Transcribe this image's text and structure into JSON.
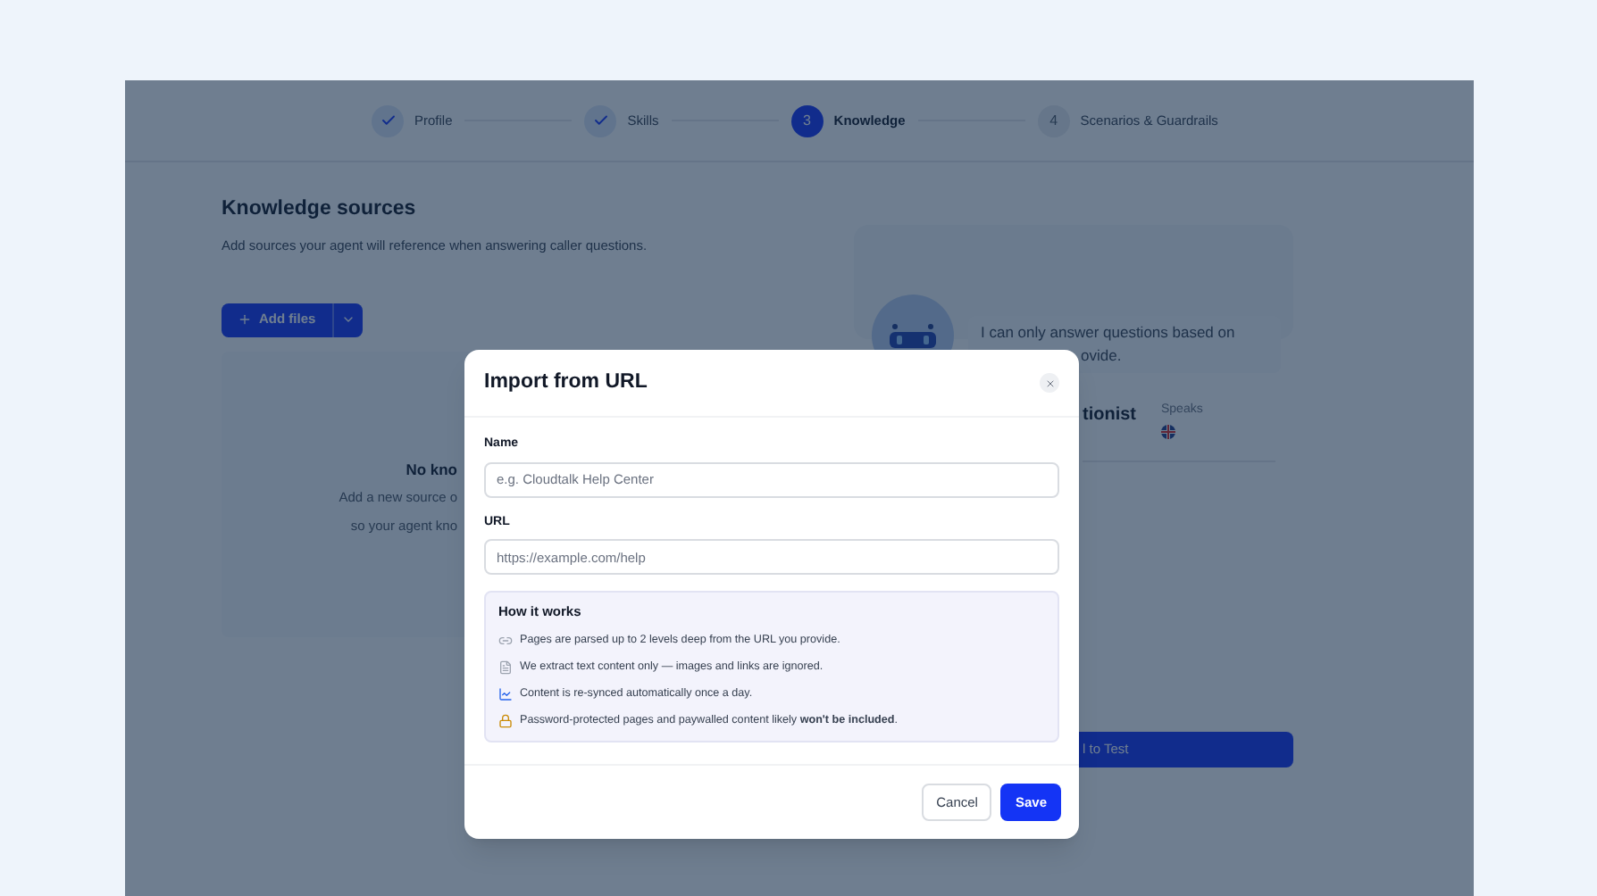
{
  "stepper": {
    "steps": [
      {
        "label": "Profile",
        "completed": true,
        "selected": false
      },
      {
        "label": "Skills",
        "completed": true,
        "selected": false
      },
      {
        "label": "Knowledge",
        "completed": false,
        "selected": true,
        "number": "3"
      },
      {
        "label": "Scenarios & Guardrails",
        "completed": false,
        "selected": false,
        "number": "4"
      }
    ]
  },
  "knowledge": {
    "title": "Knowledge sources",
    "subtitle": "Add sources your agent will reference when answering caller questions.",
    "add_button": {
      "label": "Add files"
    },
    "empty_state": {
      "title": "No kno",
      "lines": [
        "Add a new source o",
        "so your agent kno"
      ]
    }
  },
  "preview": {
    "bubble_lines": [
      "I can only answer questions based on",
      "ovide."
    ],
    "agent_name": "tionist",
    "speaks_label": "Speaks",
    "test_button": {
      "label": "l to Test"
    }
  },
  "modal": {
    "title": "Import from URL",
    "fields": [
      {
        "label": "Name",
        "placeholder": "e.g. Cloudtalk Help Center"
      },
      {
        "label": "URL",
        "placeholder": "https://example.com/help"
      }
    ],
    "info": {
      "title": "How it works",
      "items": [
        "Pages are parsed up to 2 levels deep from the URL you provide.",
        "We extract text content only — images and links are ignored.",
        "Content is re-synced automatically once a day.",
        "Password-protected pages and paywalled content likely **won't be included**."
      ]
    },
    "buttons": [
      {
        "label": "Cancel",
        "kind": "secondary"
      },
      {
        "label": "Save",
        "kind": "primary"
      }
    ]
  }
}
